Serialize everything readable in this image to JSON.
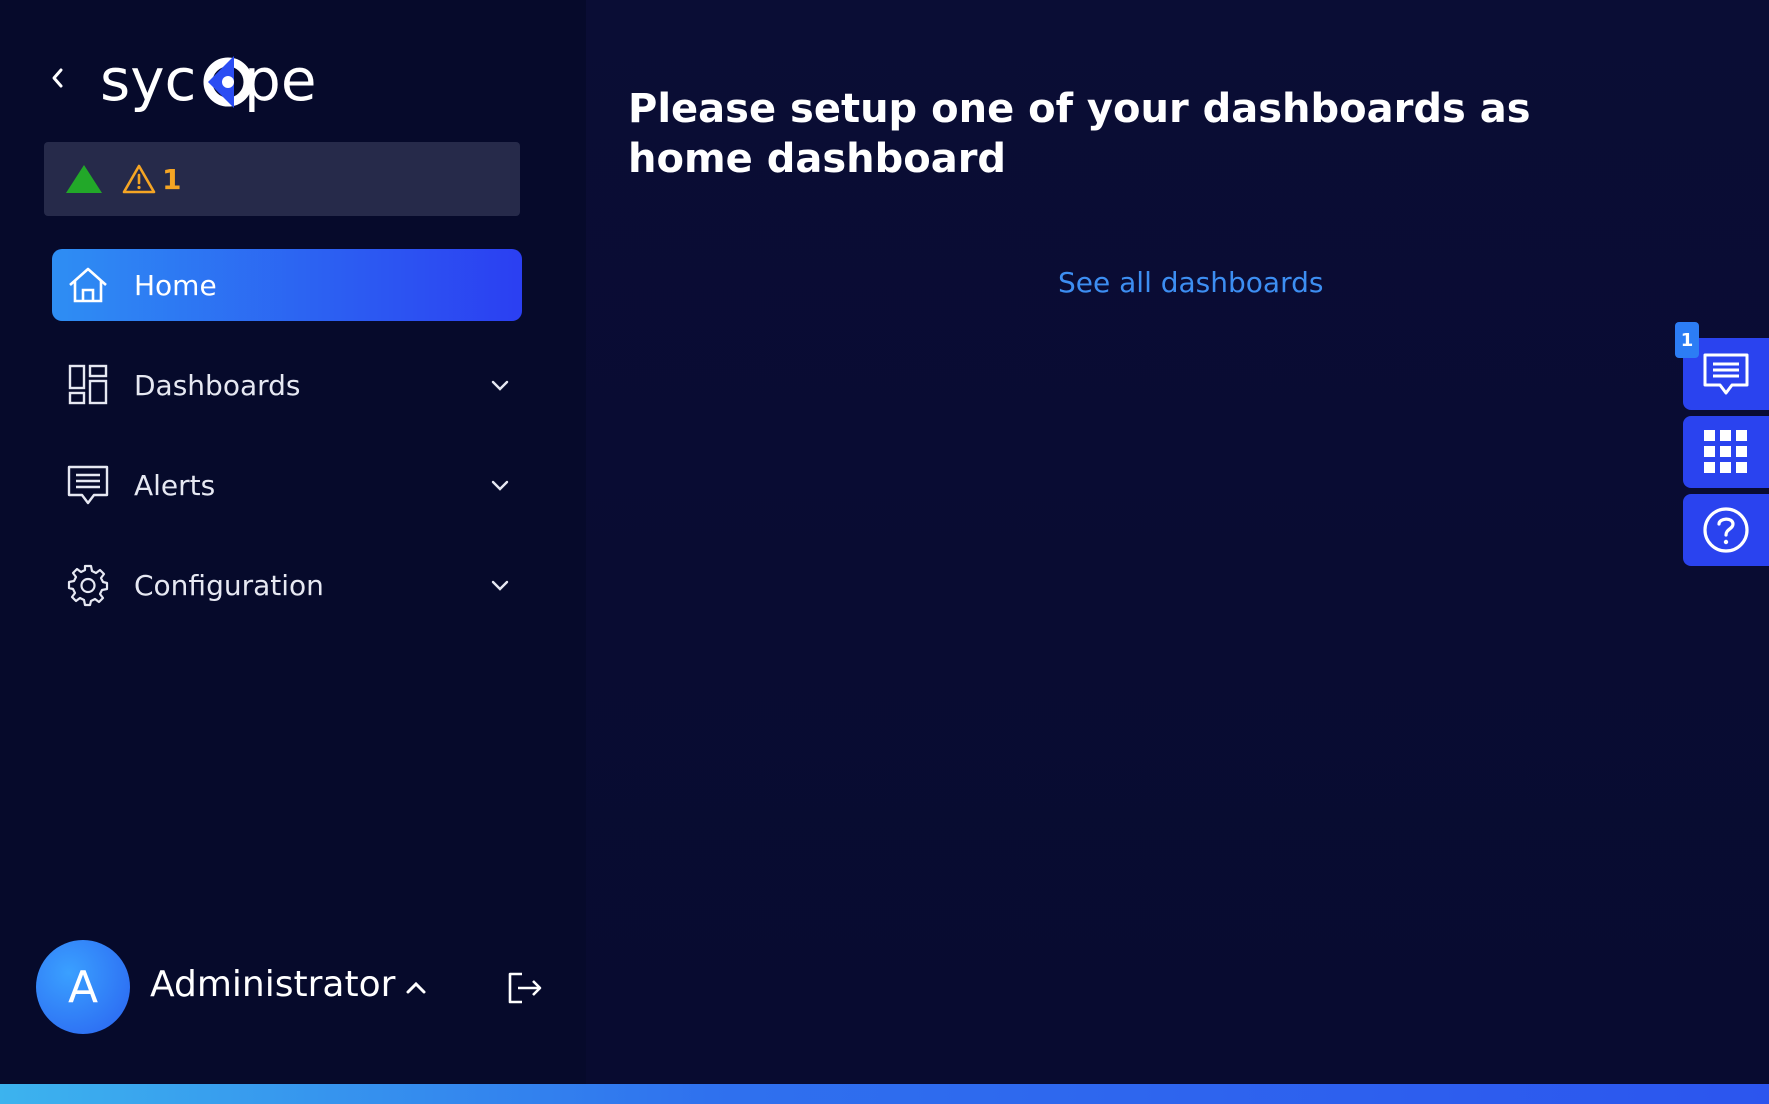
{
  "brand": {
    "logo_text": "syc pe"
  },
  "status": {
    "warning_count": "1"
  },
  "nav": {
    "items": [
      {
        "label": "Home",
        "icon": "home-icon",
        "active": true
      },
      {
        "label": "Dashboards",
        "icon": "dashboards-icon"
      },
      {
        "label": "Alerts",
        "icon": "alerts-icon"
      },
      {
        "label": "Configuration",
        "icon": "gear-icon"
      }
    ]
  },
  "user": {
    "initial": "A",
    "name": "Administrator"
  },
  "main": {
    "title": "Please setup one of your dashboards as home dashboard",
    "link": "See all dashboards"
  },
  "side_tools": {
    "notifications_badge": "1"
  },
  "colors": {
    "accent": "#2b3ff2",
    "link": "#3d8ef2",
    "warning": "#f5a524",
    "ok": "#22a829"
  }
}
